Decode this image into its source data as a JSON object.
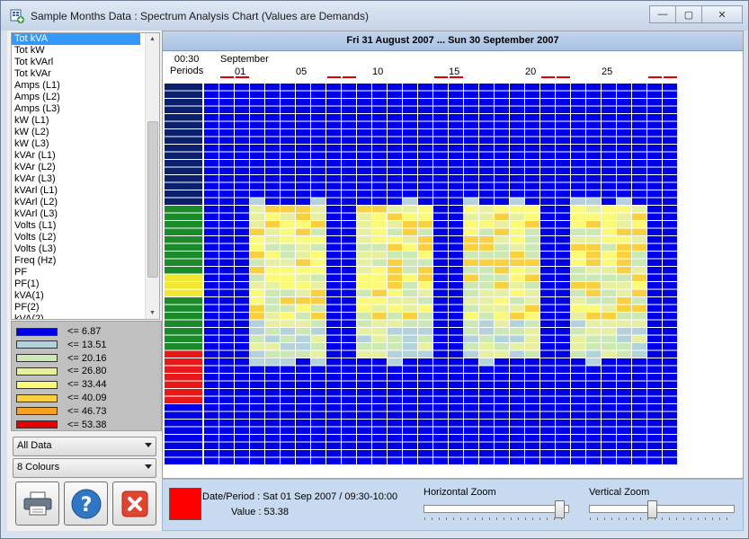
{
  "window": {
    "title": "Sample Months Data : Spectrum Analysis Chart (Values are Demands)",
    "buttons": {
      "minimize": "—",
      "restore": "▢",
      "close": "✕"
    }
  },
  "channel_list": {
    "selected": "Tot kVA",
    "items": [
      "Tot kVA",
      "Tot kW",
      "Tot kVArl",
      "Tot kVAr",
      "Amps (L1)",
      "Amps (L2)",
      "Amps (L3)",
      "kW (L1)",
      "kW (L2)",
      "kW (L3)",
      "kVAr (L1)",
      "kVAr (L2)",
      "kVAr (L3)",
      "kVArl (L1)",
      "kVArl (L2)",
      "kVArl (L3)",
      "Volts (L1)",
      "Volts (L2)",
      "Volts (L3)",
      "Freq (Hz)",
      "PF",
      "PF(1)",
      "kVA(1)",
      "PF(2)",
      "kVA(2)"
    ]
  },
  "legend": [
    {
      "label": "<= 6.87",
      "color": "#0000e6"
    },
    {
      "label": "<= 13.51",
      "color": "#b4d2dc"
    },
    {
      "label": "<= 20.16",
      "color": "#cce8b4"
    },
    {
      "label": "<= 26.80",
      "color": "#e6f0a0"
    },
    {
      "label": "<= 33.44",
      "color": "#fafa78"
    },
    {
      "label": "<= 40.09",
      "color": "#f8d040"
    },
    {
      "label": "<= 46.73",
      "color": "#f4a020"
    },
    {
      "label": "<= 53.38",
      "color": "#e60000"
    }
  ],
  "combos": {
    "data_filter": "All Data",
    "colours": "8 Colours"
  },
  "buttons": {
    "print": "printer-icon",
    "help": "help-icon",
    "close": "close-icon"
  },
  "chart": {
    "header": "Fri 31 August 2007 ... Sun 30 September 2007",
    "period_label_1": "00:30",
    "period_label_2": "Periods",
    "month": "September",
    "day_ticks": [
      "01",
      "05",
      "10",
      "15",
      "20",
      "25"
    ]
  },
  "status": {
    "swatch_color": "#ff0000",
    "date_period": "Date/Period : Sat 01 Sep 2007 / 09:30-10:00",
    "value": "Value : 53.38"
  },
  "zoom": {
    "horizontal_label": "Horizontal Zoom",
    "vertical_label": "Vertical Zoom",
    "horizontal_level": 0.96,
    "vertical_level": 0.43
  },
  "chart_data": {
    "type": "heatmap",
    "x": "days 31 Aug – 30 Sep 2007",
    "y": "00:30 periods",
    "legend_thresholds": [
      6.87,
      13.51,
      20.16,
      26.8,
      33.44,
      40.09,
      46.73,
      53.38
    ],
    "weekend_days": [
      "01",
      "02",
      "08",
      "09",
      "15",
      "16",
      "22",
      "23",
      "29",
      "30"
    ],
    "max_value_shown": 53.38
  }
}
